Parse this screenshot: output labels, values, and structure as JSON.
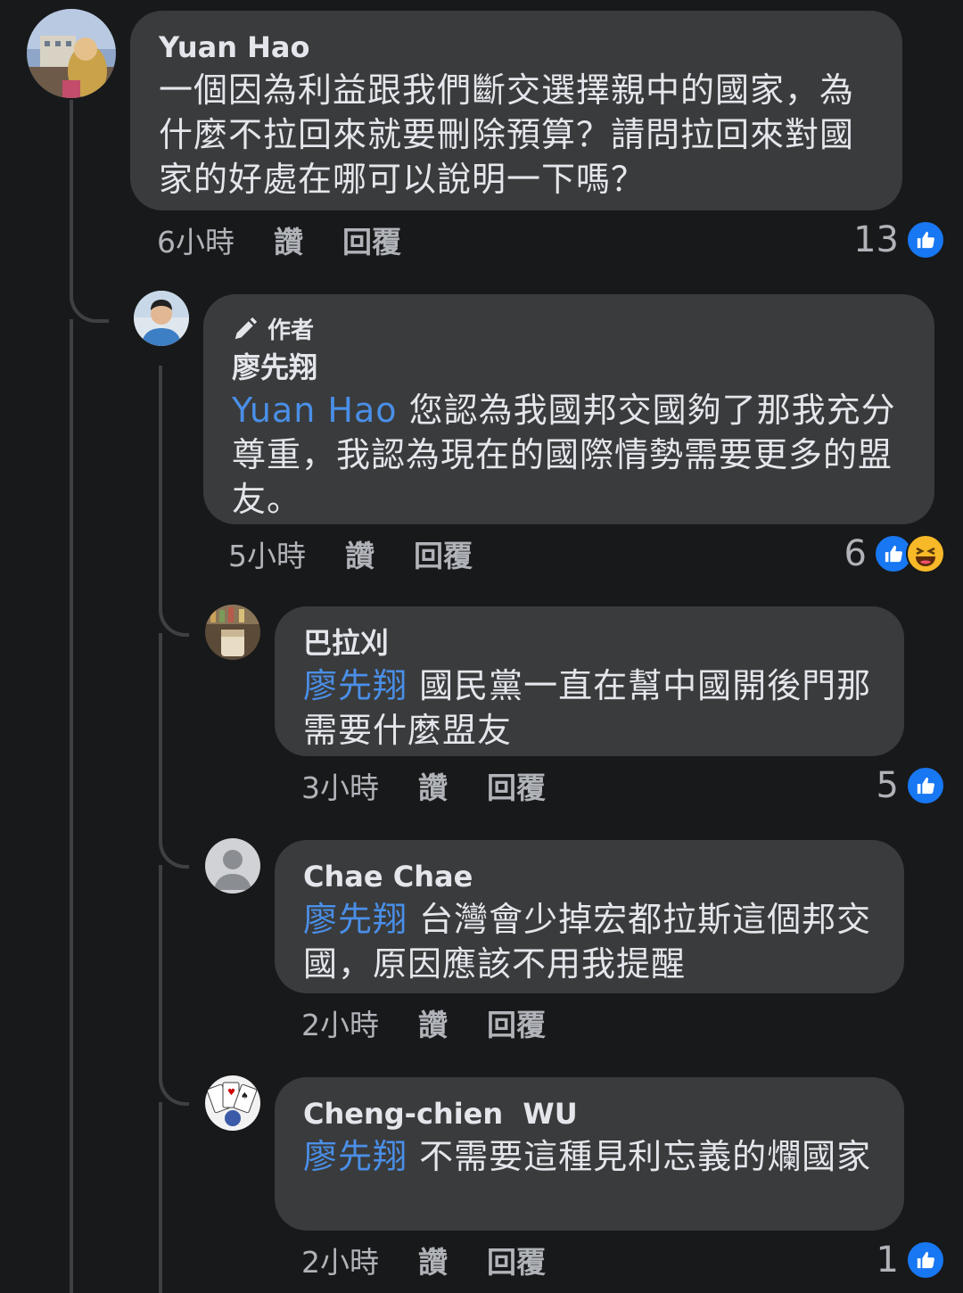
{
  "comments": [
    {
      "author": "Yuan Hao",
      "mention": "",
      "text": "一個因為利益跟我們斷交選擇親中的國家，為什麼不拉回來就要刪除預算？請問拉回來對國家的好處在哪可以說明一下嗎？",
      "time": "6小時",
      "like_action": "讚",
      "reply_action": "回覆",
      "reaction_count": "13",
      "reactions": [
        "like-icon"
      ]
    },
    {
      "badge": "作者",
      "author": "廖先翔",
      "mention": "Yuan Hao",
      "text": " 您認為我國邦交國夠了那我充分尊重，我認為現在的國際情勢需要更多的盟友。",
      "time": "5小時",
      "like_action": "讚",
      "reply_action": "回覆",
      "reaction_count": "6",
      "reactions": [
        "like-icon",
        "haha-icon"
      ]
    },
    {
      "author": "巴拉刈",
      "mention": "廖先翔",
      "text": " 國民黨一直在幫中國開後門那需要什麼盟友",
      "time": "3小時",
      "like_action": "讚",
      "reply_action": "回覆",
      "reaction_count": "5",
      "reactions": [
        "like-icon"
      ]
    },
    {
      "author": "Chae Chae",
      "mention": "廖先翔",
      "text": " 台灣會少掉宏都拉斯這個邦交國，原因應該不用我提醒",
      "time": "2小時",
      "like_action": "讚",
      "reply_action": "回覆",
      "reaction_count": "",
      "reactions": []
    },
    {
      "author": "Cheng-chien  WU",
      "mention": "廖先翔",
      "text": " 不需要這種見利忘義的爛國家",
      "time": "2小時",
      "like_action": "讚",
      "reply_action": "回覆",
      "reaction_count": "1",
      "reactions": [
        "like-icon"
      ]
    }
  ],
  "colors": {
    "background": "#18191a",
    "bubble": "#3a3b3c",
    "mention": "#4a8fe8",
    "like": "#1877f2",
    "haha": "#f7b928"
  }
}
